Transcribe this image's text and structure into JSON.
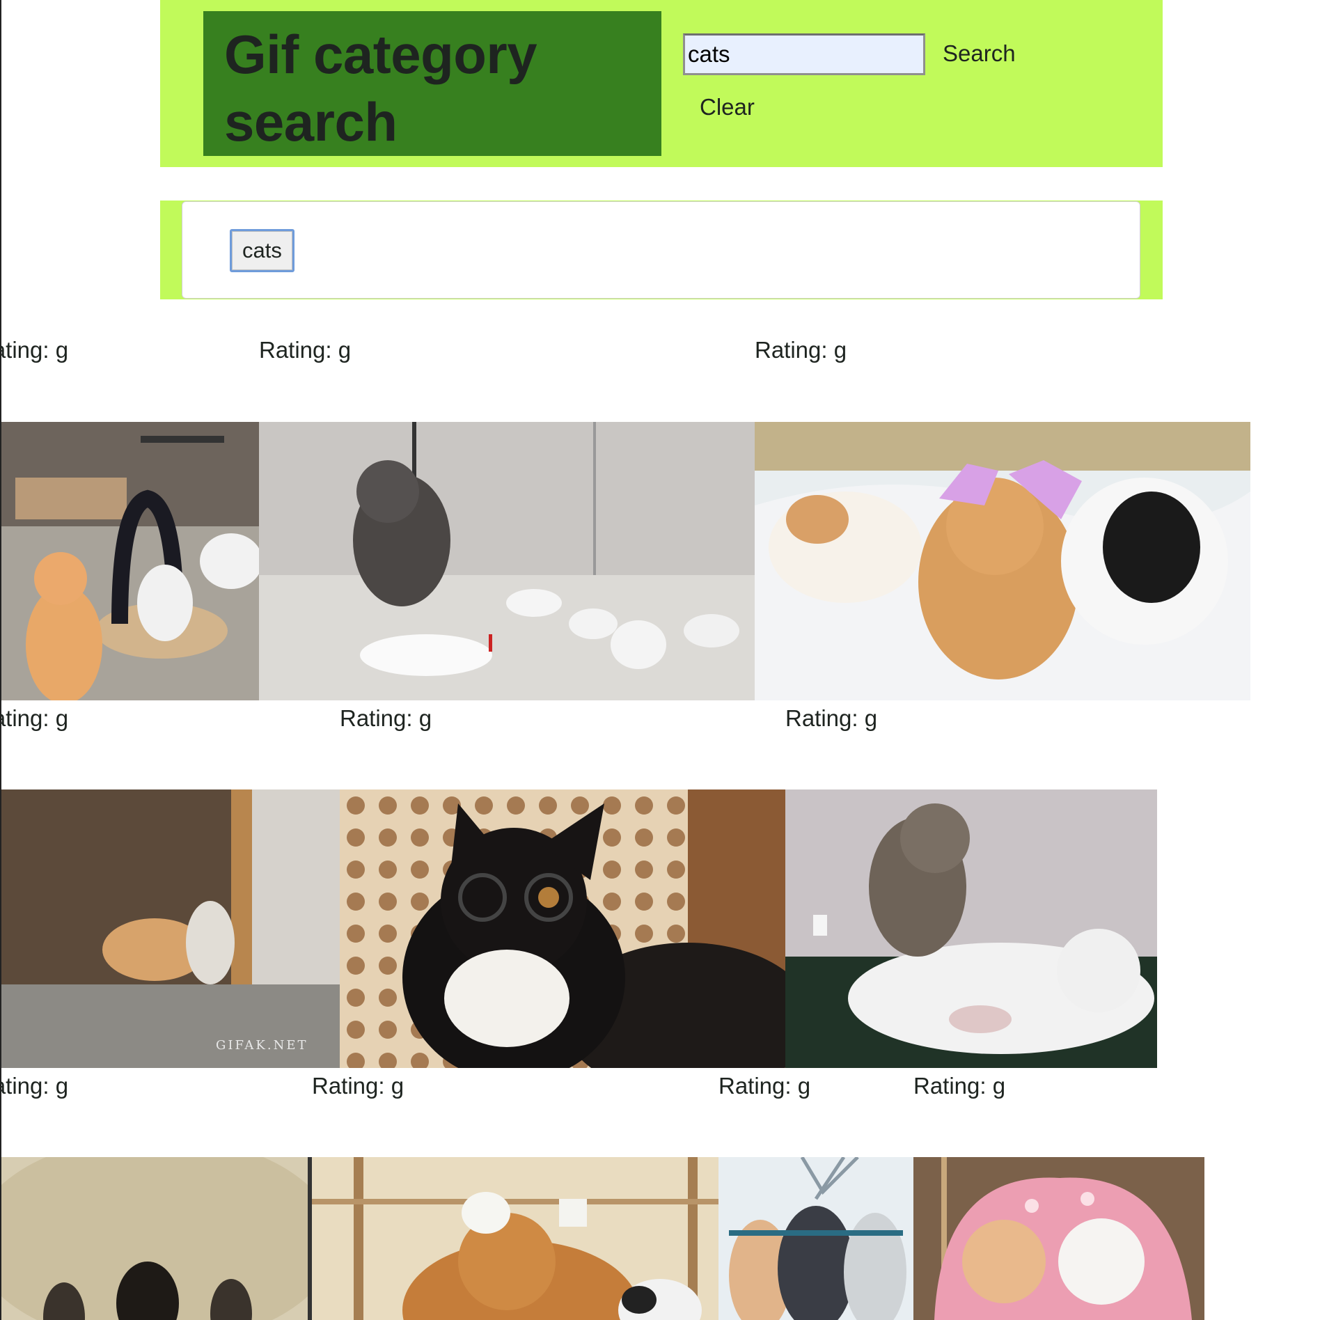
{
  "header": {
    "title": "Gif category search",
    "search_value": "cats",
    "search_label": "Search",
    "clear_label": "Clear"
  },
  "categories": [
    "cats"
  ],
  "rating_text": "Rating: g",
  "gif_rows": [
    [
      {
        "rating": "Rating: g",
        "alt": "cat playing with arch scratcher toy"
      },
      {
        "rating": "Rating: g",
        "alt": "kitten knocking down bowling pins"
      },
      {
        "rating": "Rating: g",
        "alt": "cats wearing pink cups on heads"
      }
    ],
    [
      {
        "rating": "Rating: g",
        "alt": "cats at doorway"
      },
      {
        "rating": "Rating: g",
        "alt": "black cat with glasses"
      },
      {
        "rating": "Rating: g",
        "alt": "kitten massaging white cat"
      }
    ],
    [
      {
        "rating": "Rating: g",
        "alt": "blurry close-up of paw"
      },
      {
        "rating": "Rating: g",
        "alt": "cat wearing chef hats"
      },
      {
        "rating": "Rating: g",
        "alt": "three cats sitting on bars"
      },
      {
        "rating": "Rating: g",
        "alt": "two cats in pink hoodie"
      }
    ]
  ],
  "watermarks": {
    "gifak": "GIFAK.NET"
  }
}
